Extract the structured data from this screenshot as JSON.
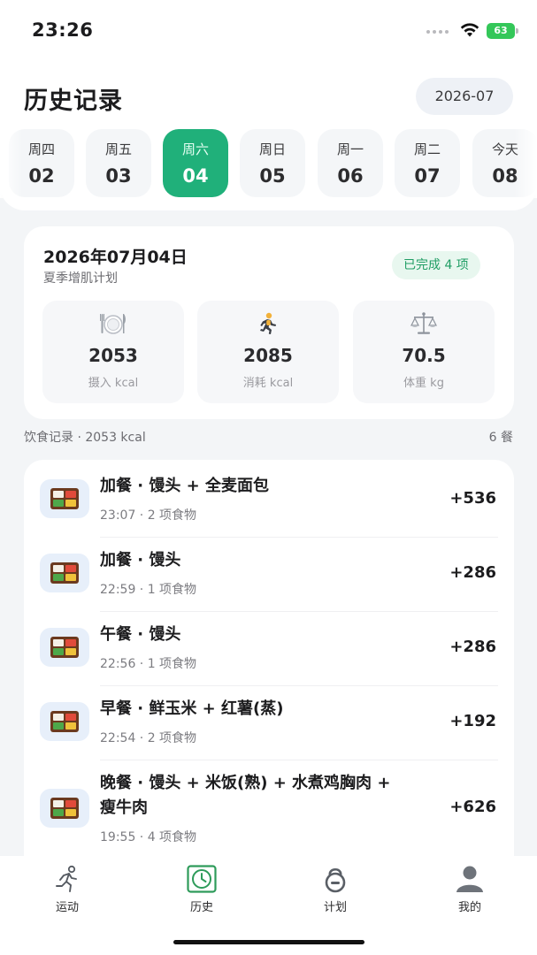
{
  "status_bar": {
    "time": "23:26",
    "battery": "63"
  },
  "header": {
    "title": "历史记录",
    "month": "2026-07"
  },
  "week": {
    "days": [
      {
        "name": "周四",
        "date": "02"
      },
      {
        "name": "周五",
        "date": "03"
      },
      {
        "name": "周六",
        "date": "04",
        "active": true
      },
      {
        "name": "周日",
        "date": "05"
      },
      {
        "name": "周一",
        "date": "06"
      },
      {
        "name": "周二",
        "date": "07"
      },
      {
        "name": "今天",
        "date": "08"
      }
    ]
  },
  "summary": {
    "date": "2026年07月04日",
    "plan": "夏季增肌计划",
    "badge": "已完成 4 项",
    "stats": [
      {
        "icon": "plate-cutlery-icon",
        "value": "2053",
        "label": "摄入 kcal"
      },
      {
        "icon": "running-person-icon",
        "value": "2085",
        "label": "消耗 kcal"
      },
      {
        "icon": "balance-scale-icon",
        "value": "70.5",
        "label": "体重 kg"
      }
    ]
  },
  "meals_section": {
    "label": "饮食记录 · 2053 kcal",
    "count": "6 餐"
  },
  "meals": [
    {
      "name": "加餐 · 馒头 + 全麦面包",
      "meta": "23:07 · 2 项食物",
      "kcal": "+536"
    },
    {
      "name": "加餐 · 馒头",
      "meta": "22:59 · 1 项食物",
      "kcal": "+286"
    },
    {
      "name": "午餐 · 馒头",
      "meta": "22:56 · 1 项食物",
      "kcal": "+286"
    },
    {
      "name": "早餐 · 鲜玉米 + 红薯(蒸)",
      "meta": "22:54 · 2 项食物",
      "kcal": "+192"
    },
    {
      "name_line1": "晚餐 · 馒头 + 米饭(熟) + 水煮鸡胸肉 +",
      "name_line2": "瘦牛肉",
      "meta": "19:55 · 4 项食物",
      "kcal": "+626"
    }
  ],
  "tabs": [
    {
      "label": "运动",
      "icon": "running-icon"
    },
    {
      "label": "历史",
      "icon": "clock-icon",
      "active": true
    },
    {
      "label": "计划",
      "icon": "kettlebell-icon"
    },
    {
      "label": "我的",
      "icon": "person-icon"
    }
  ],
  "colors": {
    "accent": "#20b07a",
    "badge_text": "#1f9d64",
    "background": "#f3f5f7"
  }
}
